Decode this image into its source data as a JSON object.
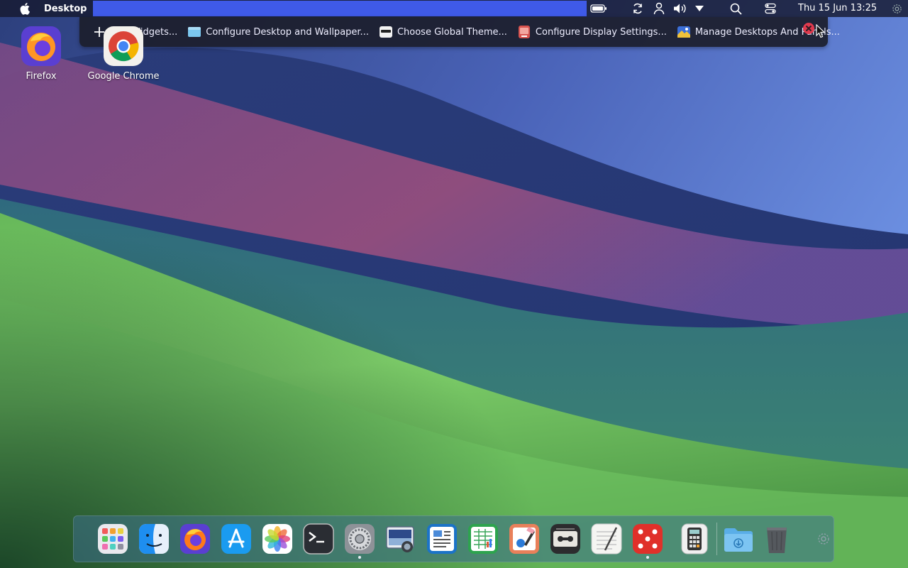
{
  "menubar": {
    "app_name": "Desktop",
    "clock": "Thu 15 Jun 13:25",
    "tray_icons": [
      "battery-icon",
      "sync-icon",
      "user-icon",
      "volume-icon",
      "chevron-down-icon",
      "search-icon",
      "control-center-icon",
      "settings-gear-icon"
    ]
  },
  "toolbar": {
    "add_widgets": "Add Widgets...",
    "configure_desktop": "Configure Desktop and Wallpaper...",
    "global_theme": "Choose Global Theme...",
    "display_settings": "Configure Display Settings...",
    "manage_desktops": "Manage Desktops And Panels..."
  },
  "desktop_icons": {
    "firefox": "Firefox",
    "chrome": "Google Chrome"
  },
  "dock": {
    "apps": [
      "launchpad",
      "finder",
      "firefox",
      "app-store",
      "photos",
      "terminal",
      "system-settings",
      "screenshot",
      "text-editor",
      "spreadsheet",
      "image-editor",
      "tape-recorder",
      "notes",
      "dice-game",
      "calculator",
      "downloads-folder",
      "trash"
    ],
    "running": [
      "system-settings",
      "dice-game"
    ]
  },
  "colors": {
    "menu_highlight": "#3f5ae8",
    "close_button": "#e03a4e"
  }
}
